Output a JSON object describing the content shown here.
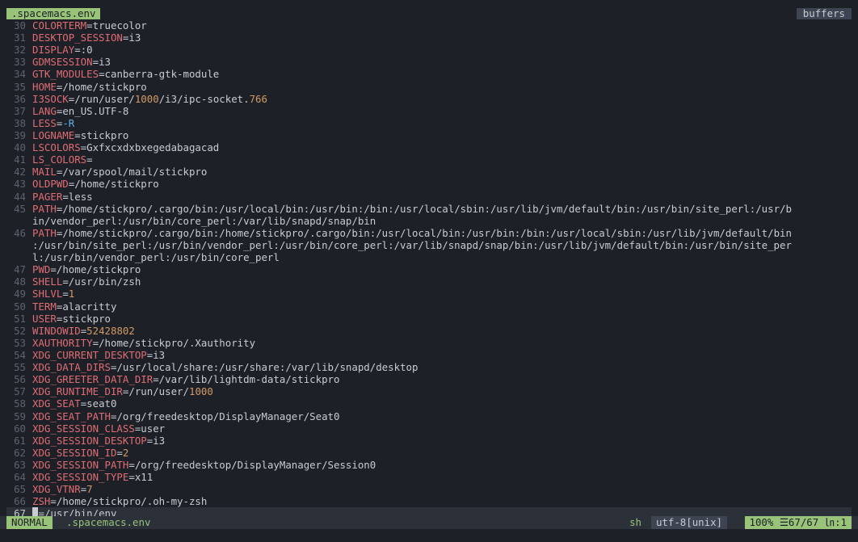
{
  "tabbar": {
    "active_tab": ".spacemacs.env",
    "right_label": "buffers"
  },
  "colors": {
    "background": "#1d2127",
    "key": "#e06c75",
    "number": "#d19a66",
    "flag": "#61afef",
    "accent_green": "#98c379"
  },
  "lines": [
    {
      "n": "30",
      "segs": [
        {
          "c": "k",
          "t": "COLORTERM"
        },
        {
          "c": "e",
          "t": "="
        },
        {
          "c": "v",
          "t": "truecolor"
        }
      ]
    },
    {
      "n": "31",
      "segs": [
        {
          "c": "k",
          "t": "DESKTOP_SESSION"
        },
        {
          "c": "e",
          "t": "="
        },
        {
          "c": "v",
          "t": "i3"
        }
      ]
    },
    {
      "n": "32",
      "segs": [
        {
          "c": "k",
          "t": "DISPLAY"
        },
        {
          "c": "e",
          "t": "="
        },
        {
          "c": "v",
          "t": ":0"
        }
      ]
    },
    {
      "n": "33",
      "segs": [
        {
          "c": "k",
          "t": "GDMSESSION"
        },
        {
          "c": "e",
          "t": "="
        },
        {
          "c": "v",
          "t": "i3"
        }
      ]
    },
    {
      "n": "34",
      "segs": [
        {
          "c": "k",
          "t": "GTK_MODULES"
        },
        {
          "c": "e",
          "t": "="
        },
        {
          "c": "v",
          "t": "canberra-gtk-module"
        }
      ]
    },
    {
      "n": "35",
      "segs": [
        {
          "c": "k",
          "t": "HOME"
        },
        {
          "c": "e",
          "t": "="
        },
        {
          "c": "v",
          "t": "/home/stickpro"
        }
      ]
    },
    {
      "n": "36",
      "segs": [
        {
          "c": "k",
          "t": "I3SOCK"
        },
        {
          "c": "e",
          "t": "="
        },
        {
          "c": "v",
          "t": "/run/user/"
        },
        {
          "c": "n",
          "t": "1000"
        },
        {
          "c": "v",
          "t": "/i3/ipc-socket."
        },
        {
          "c": "n",
          "t": "766"
        }
      ]
    },
    {
      "n": "37",
      "segs": [
        {
          "c": "k",
          "t": "LANG"
        },
        {
          "c": "e",
          "t": "="
        },
        {
          "c": "v",
          "t": "en_US.UTF-8"
        }
      ]
    },
    {
      "n": "38",
      "segs": [
        {
          "c": "k",
          "t": "LESS"
        },
        {
          "c": "e",
          "t": "="
        },
        {
          "c": "b",
          "t": "-R"
        }
      ]
    },
    {
      "n": "39",
      "segs": [
        {
          "c": "k",
          "t": "LOGNAME"
        },
        {
          "c": "e",
          "t": "="
        },
        {
          "c": "v",
          "t": "stickpro"
        }
      ]
    },
    {
      "n": "40",
      "segs": [
        {
          "c": "k",
          "t": "LSCOLORS"
        },
        {
          "c": "e",
          "t": "="
        },
        {
          "c": "v",
          "t": "Gxfxcxdxbxegedabagacad"
        }
      ]
    },
    {
      "n": "41",
      "segs": [
        {
          "c": "k",
          "t": "LS_COLORS"
        },
        {
          "c": "e",
          "t": "="
        }
      ]
    },
    {
      "n": "42",
      "segs": [
        {
          "c": "k",
          "t": "MAIL"
        },
        {
          "c": "e",
          "t": "="
        },
        {
          "c": "v",
          "t": "/var/spool/mail/stickpro"
        }
      ]
    },
    {
      "n": "43",
      "segs": [
        {
          "c": "k",
          "t": "OLDPWD"
        },
        {
          "c": "e",
          "t": "="
        },
        {
          "c": "v",
          "t": "/home/stickpro"
        }
      ]
    },
    {
      "n": "44",
      "segs": [
        {
          "c": "k",
          "t": "PAGER"
        },
        {
          "c": "e",
          "t": "="
        },
        {
          "c": "v",
          "t": "less"
        }
      ]
    },
    {
      "n": "45",
      "segs": [
        {
          "c": "k",
          "t": "PATH"
        },
        {
          "c": "e",
          "t": "="
        },
        {
          "c": "v",
          "t": "/home/stickpro/.cargo/bin:/usr/local/bin:/usr/bin:/bin:/usr/local/sbin:/usr/lib/jvm/default/bin:/usr/bin/site_perl:/usr/b"
        }
      ]
    },
    {
      "n": "",
      "segs": [
        {
          "c": "v",
          "t": "in/vendor_perl:/usr/bin/core_perl:/var/lib/snapd/snap/bin"
        }
      ]
    },
    {
      "n": "46",
      "segs": [
        {
          "c": "k",
          "t": "PATH"
        },
        {
          "c": "e",
          "t": "="
        },
        {
          "c": "v",
          "t": "/home/stickpro/.cargo/bin:/home/stickpro/.cargo/bin:/usr/local/bin:/usr/bin:/bin:/usr/local/sbin:/usr/lib/jvm/default/bin"
        }
      ]
    },
    {
      "n": "",
      "segs": [
        {
          "c": "v",
          "t": ":/usr/bin/site_perl:/usr/bin/vendor_perl:/usr/bin/core_perl:/var/lib/snapd/snap/bin:/usr/lib/jvm/default/bin:/usr/bin/site_per"
        }
      ]
    },
    {
      "n": "",
      "segs": [
        {
          "c": "v",
          "t": "l:/usr/bin/vendor_perl:/usr/bin/core_perl"
        }
      ]
    },
    {
      "n": "47",
      "segs": [
        {
          "c": "k",
          "t": "PWD"
        },
        {
          "c": "e",
          "t": "="
        },
        {
          "c": "v",
          "t": "/home/stickpro"
        }
      ]
    },
    {
      "n": "48",
      "segs": [
        {
          "c": "k",
          "t": "SHELL"
        },
        {
          "c": "e",
          "t": "="
        },
        {
          "c": "v",
          "t": "/usr/bin/zsh"
        }
      ]
    },
    {
      "n": "49",
      "segs": [
        {
          "c": "k",
          "t": "SHLVL"
        },
        {
          "c": "e",
          "t": "="
        },
        {
          "c": "n",
          "t": "1"
        }
      ]
    },
    {
      "n": "50",
      "segs": [
        {
          "c": "k",
          "t": "TERM"
        },
        {
          "c": "e",
          "t": "="
        },
        {
          "c": "v",
          "t": "alacritty"
        }
      ]
    },
    {
      "n": "51",
      "segs": [
        {
          "c": "k",
          "t": "USER"
        },
        {
          "c": "e",
          "t": "="
        },
        {
          "c": "v",
          "t": "stickpro"
        }
      ]
    },
    {
      "n": "52",
      "segs": [
        {
          "c": "k",
          "t": "WINDOWID"
        },
        {
          "c": "e",
          "t": "="
        },
        {
          "c": "n",
          "t": "52428802"
        }
      ]
    },
    {
      "n": "53",
      "segs": [
        {
          "c": "k",
          "t": "XAUTHORITY"
        },
        {
          "c": "e",
          "t": "="
        },
        {
          "c": "v",
          "t": "/home/stickpro/.Xauthority"
        }
      ]
    },
    {
      "n": "54",
      "segs": [
        {
          "c": "k",
          "t": "XDG_CURRENT_DESKTOP"
        },
        {
          "c": "e",
          "t": "="
        },
        {
          "c": "v",
          "t": "i3"
        }
      ]
    },
    {
      "n": "55",
      "segs": [
        {
          "c": "k",
          "t": "XDG_DATA_DIRS"
        },
        {
          "c": "e",
          "t": "="
        },
        {
          "c": "v",
          "t": "/usr/local/share:/usr/share:/var/lib/snapd/desktop"
        }
      ]
    },
    {
      "n": "56",
      "segs": [
        {
          "c": "k",
          "t": "XDG_GREETER_DATA_DIR"
        },
        {
          "c": "e",
          "t": "="
        },
        {
          "c": "v",
          "t": "/var/lib/lightdm-data/stickpro"
        }
      ]
    },
    {
      "n": "57",
      "segs": [
        {
          "c": "k",
          "t": "XDG_RUNTIME_DIR"
        },
        {
          "c": "e",
          "t": "="
        },
        {
          "c": "v",
          "t": "/run/user/"
        },
        {
          "c": "n",
          "t": "1000"
        }
      ]
    },
    {
      "n": "58",
      "segs": [
        {
          "c": "k",
          "t": "XDG_SEAT"
        },
        {
          "c": "e",
          "t": "="
        },
        {
          "c": "v",
          "t": "seat0"
        }
      ]
    },
    {
      "n": "59",
      "segs": [
        {
          "c": "k",
          "t": "XDG_SEAT_PATH"
        },
        {
          "c": "e",
          "t": "="
        },
        {
          "c": "v",
          "t": "/org/freedesktop/DisplayManager/Seat0"
        }
      ]
    },
    {
      "n": "60",
      "segs": [
        {
          "c": "k",
          "t": "XDG_SESSION_CLASS"
        },
        {
          "c": "e",
          "t": "="
        },
        {
          "c": "v",
          "t": "user"
        }
      ]
    },
    {
      "n": "61",
      "segs": [
        {
          "c": "k",
          "t": "XDG_SESSION_DESKTOP"
        },
        {
          "c": "e",
          "t": "="
        },
        {
          "c": "v",
          "t": "i3"
        }
      ]
    },
    {
      "n": "62",
      "segs": [
        {
          "c": "k",
          "t": "XDG_SESSION_ID"
        },
        {
          "c": "e",
          "t": "="
        },
        {
          "c": "n",
          "t": "2"
        }
      ]
    },
    {
      "n": "63",
      "segs": [
        {
          "c": "k",
          "t": "XDG_SESSION_PATH"
        },
        {
          "c": "e",
          "t": "="
        },
        {
          "c": "v",
          "t": "/org/freedesktop/DisplayManager/Session0"
        }
      ]
    },
    {
      "n": "64",
      "segs": [
        {
          "c": "k",
          "t": "XDG_SESSION_TYPE"
        },
        {
          "c": "e",
          "t": "="
        },
        {
          "c": "v",
          "t": "x11"
        }
      ]
    },
    {
      "n": "65",
      "segs": [
        {
          "c": "k",
          "t": "XDG_VTNR"
        },
        {
          "c": "e",
          "t": "="
        },
        {
          "c": "n",
          "t": "7"
        }
      ]
    },
    {
      "n": "66",
      "segs": [
        {
          "c": "k",
          "t": "ZSH"
        },
        {
          "c": "e",
          "t": "="
        },
        {
          "c": "v",
          "t": "/home/stickpro/.oh-my-zsh"
        }
      ]
    },
    {
      "n": "67",
      "current": true,
      "segs": [
        {
          "c": "cursor",
          "t": "_"
        },
        {
          "c": "e",
          "t": "="
        },
        {
          "c": "v",
          "t": "/usr/bin/env"
        }
      ]
    }
  ],
  "statusbar": {
    "mode": "NORMAL",
    "file": ".spacemacs.env",
    "filetype": "sh",
    "encoding": "utf-8[unix]",
    "position": "100% ☰67/67 ㏑:1"
  }
}
